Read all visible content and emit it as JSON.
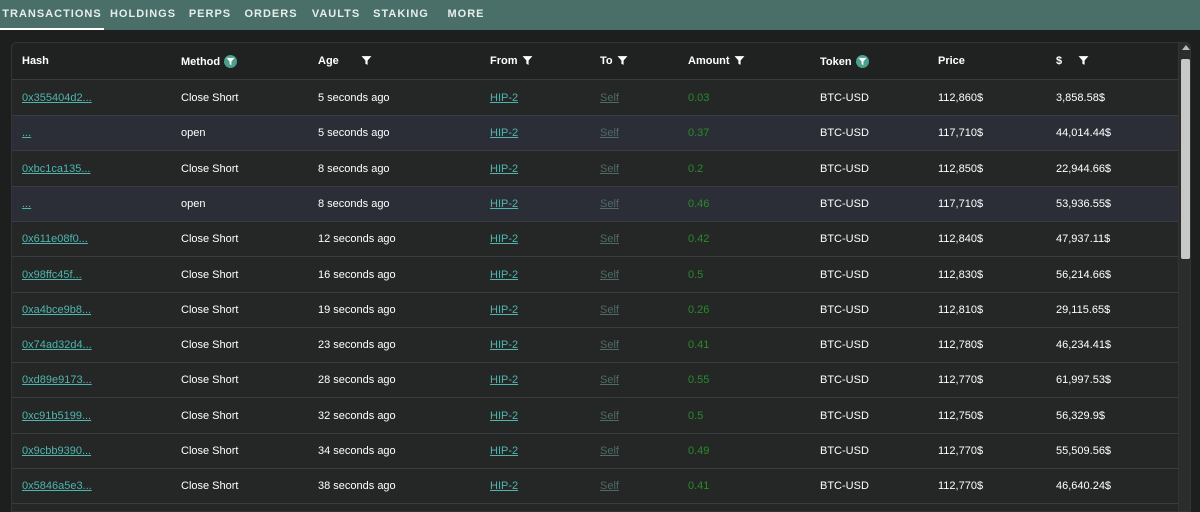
{
  "tabs": [
    "TRANSACTIONS",
    "HOLDINGS",
    "PERPS",
    "ORDERS",
    "VAULTS",
    "STAKING",
    "MORE"
  ],
  "active_tab": "TRANSACTIONS",
  "columns": {
    "hash": "Hash",
    "method": "Method",
    "age": "Age",
    "from": "From",
    "to": "To",
    "amount": "Amount",
    "token": "Token",
    "price": "Price",
    "usd": "$"
  },
  "rows": [
    {
      "hash": "0x355404d2...",
      "method": "Close Short",
      "age": "5 seconds ago",
      "from": "HIP-2",
      "to": "Self",
      "amount": "0.03",
      "token": "BTC-USD",
      "price": "112,860$",
      "usd": "3,858.58$"
    },
    {
      "hash": "...",
      "method": "open",
      "age": "5 seconds ago",
      "from": "HIP-2",
      "to": "Self",
      "amount": "0.37",
      "token": "BTC-USD",
      "price": "117,710$",
      "usd": "44,014.44$"
    },
    {
      "hash": "0xbc1ca135...",
      "method": "Close Short",
      "age": "8 seconds ago",
      "from": "HIP-2",
      "to": "Self",
      "amount": "0.2",
      "token": "BTC-USD",
      "price": "112,850$",
      "usd": "22,944.66$"
    },
    {
      "hash": "...",
      "method": "open",
      "age": "8 seconds ago",
      "from": "HIP-2",
      "to": "Self",
      "amount": "0.46",
      "token": "BTC-USD",
      "price": "117,710$",
      "usd": "53,936.55$"
    },
    {
      "hash": "0x611e08f0...",
      "method": "Close Short",
      "age": "12 seconds ago",
      "from": "HIP-2",
      "to": "Self",
      "amount": "0.42",
      "token": "BTC-USD",
      "price": "112,840$",
      "usd": "47,937.11$"
    },
    {
      "hash": "0x98ffc45f...",
      "method": "Close Short",
      "age": "16 seconds ago",
      "from": "HIP-2",
      "to": "Self",
      "amount": "0.5",
      "token": "BTC-USD",
      "price": "112,830$",
      "usd": "56,214.66$"
    },
    {
      "hash": "0xa4bce9b8...",
      "method": "Close Short",
      "age": "19 seconds ago",
      "from": "HIP-2",
      "to": "Self",
      "amount": "0.26",
      "token": "BTC-USD",
      "price": "112,810$",
      "usd": "29,115.65$"
    },
    {
      "hash": "0x74ad32d4...",
      "method": "Close Short",
      "age": "23 seconds ago",
      "from": "HIP-2",
      "to": "Self",
      "amount": "0.41",
      "token": "BTC-USD",
      "price": "112,780$",
      "usd": "46,234.41$"
    },
    {
      "hash": "0xd89e9173...",
      "method": "Close Short",
      "age": "28 seconds ago",
      "from": "HIP-2",
      "to": "Self",
      "amount": "0.55",
      "token": "BTC-USD",
      "price": "112,770$",
      "usd": "61,997.53$"
    },
    {
      "hash": "0xc91b5199...",
      "method": "Close Short",
      "age": "32 seconds ago",
      "from": "HIP-2",
      "to": "Self",
      "amount": "0.5",
      "token": "BTC-USD",
      "price": "112,750$",
      "usd": "56,329.9$"
    },
    {
      "hash": "0x9cbb9390...",
      "method": "Close Short",
      "age": "34 seconds ago",
      "from": "HIP-2",
      "to": "Self",
      "amount": "0.49",
      "token": "BTC-USD",
      "price": "112,770$",
      "usd": "55,509.56$"
    },
    {
      "hash": "0x5846a5e3...",
      "method": "Close Short",
      "age": "38 seconds ago",
      "from": "HIP-2",
      "to": "Self",
      "amount": "0.41",
      "token": "BTC-USD",
      "price": "112,770$",
      "usd": "46,640.24$"
    }
  ],
  "colors": {
    "tab_bar": "#4a6e68",
    "link": "#4fb6ad",
    "amount": "#2a8a2a",
    "self_link": "#4f6a68",
    "alt_row": "#2b2e36"
  }
}
